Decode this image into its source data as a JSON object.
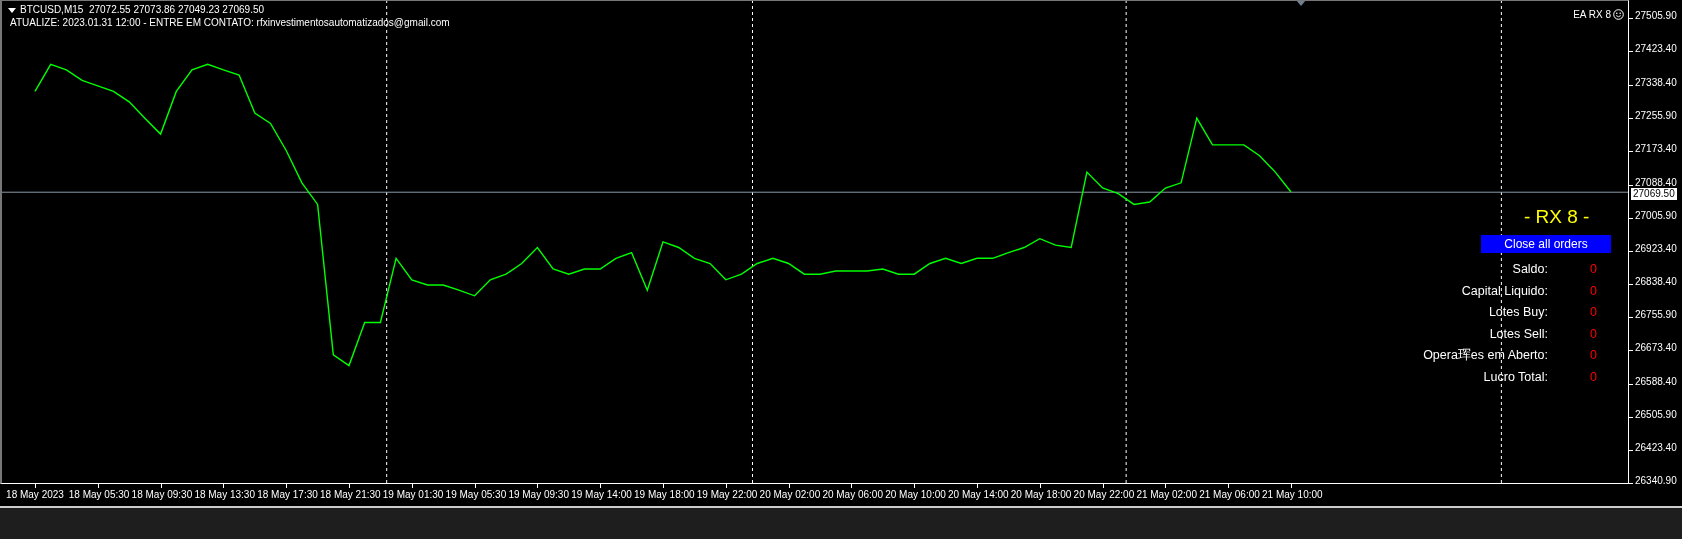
{
  "chart": {
    "header": {
      "symbol_line": "BTCUSD,M15  27072.55 27073.86 27049.23 27069.50",
      "notice": "ATUALIZE: 2023.01.31 12:00 - ENTRE EM CONTATO: rfxinvestimentosautomatizados@gmail.com"
    },
    "ea_label": "EA RX 8",
    "chart_data": {
      "type": "line",
      "categories": [
        "18 May 2023",
        null,
        null,
        null,
        "18 May 05:30",
        null,
        null,
        null,
        "18 May 09:30",
        null,
        null,
        null,
        "18 May 13:30",
        null,
        null,
        null,
        "18 May 17:30",
        null,
        null,
        null,
        "18 May 21:30",
        null,
        null,
        null,
        "19 May 01:30",
        null,
        null,
        null,
        "19 May 05:30",
        null,
        null,
        null,
        "19 May 09:30",
        null,
        null,
        null,
        "19 May 14:00",
        null,
        null,
        null,
        "19 May 18:00",
        null,
        null,
        null,
        "19 May 22:00",
        null,
        null,
        null,
        "20 May 02:00",
        null,
        null,
        null,
        "20 May 06:00",
        null,
        null,
        null,
        "20 May 10:00",
        null,
        null,
        null,
        "20 May 14:00",
        null,
        null,
        null,
        "20 May 18:00",
        null,
        null,
        null,
        "20 May 22:00",
        null,
        null,
        null,
        "21 May 02:00",
        null,
        null,
        null,
        "21 May 06:00",
        null,
        null,
        null,
        "21 May 10:00"
      ],
      "series": [
        {
          "color": "#00ff00",
          "values": [
            27322,
            27390,
            27376,
            27350,
            27336,
            27322,
            27296,
            27255,
            27215,
            27322,
            27376,
            27390,
            27376,
            27363,
            27268,
            27242,
            27174,
            27093,
            27039,
            26662,
            26635,
            26743,
            26743,
            26904,
            26850,
            26837,
            26837,
            26824,
            26810,
            26850,
            26864,
            26891,
            26931,
            26877,
            26864,
            26877,
            26877,
            26904,
            26918,
            26824,
            26945,
            26931,
            26904,
            26891,
            26850,
            26864,
            26891,
            26904,
            26891,
            26864,
            26864,
            26872,
            26872,
            26872,
            26877,
            26864,
            26864,
            26891,
            26904,
            26891,
            26904,
            26904,
            26918,
            26931,
            26953,
            26937,
            26931,
            27120,
            27080,
            27066,
            27039,
            27045,
            27080,
            27093,
            27255,
            27188,
            27188,
            27188,
            27161,
            27120,
            27070
          ]
        }
      ],
      "ylim": [
        26338.4,
        27551.1
      ],
      "ref_lines": [
        {
          "axis": "y",
          "value": 27069.5,
          "label": "27069.50"
        }
      ],
      "yticks": [
        {
          "value": 27505.9,
          "label": "27505.90"
        },
        {
          "value": 27423.4,
          "label": "27423.40"
        },
        {
          "value": 27338.4,
          "label": "27338.40"
        },
        {
          "value": 27255.9,
          "label": "27255.90"
        },
        {
          "value": 27173.4,
          "label": "27173.40"
        },
        {
          "value": 27088.4,
          "label": "27088.40"
        },
        {
          "value": 27005.9,
          "label": "27005.90"
        },
        {
          "value": 26923.4,
          "label": "26923.40"
        },
        {
          "value": 26838.4,
          "label": "26838.40"
        },
        {
          "value": 26755.9,
          "label": "26755.90"
        },
        {
          "value": 26673.4,
          "label": "26673.40"
        },
        {
          "value": 26588.4,
          "label": "26588.40"
        },
        {
          "value": 26505.9,
          "label": "26505.90"
        },
        {
          "value": 26423.4,
          "label": "26423.40"
        },
        {
          "value": 26340.9,
          "label": "26340.90"
        }
      ]
    }
  },
  "panel": {
    "title": "- RX 8 -",
    "button": "Close all orders",
    "rows": [
      {
        "label": "Saldo:",
        "value": "0"
      },
      {
        "label": "Capital Liquido:",
        "value": "0"
      },
      {
        "label": "Lotes Buy:",
        "value": "0"
      },
      {
        "label": "Lotes Sell:",
        "value": "0"
      },
      {
        "label": "Opera珲es em Aberto:",
        "value": "0"
      },
      {
        "label": "Lucro Total:",
        "value": "0"
      }
    ]
  }
}
